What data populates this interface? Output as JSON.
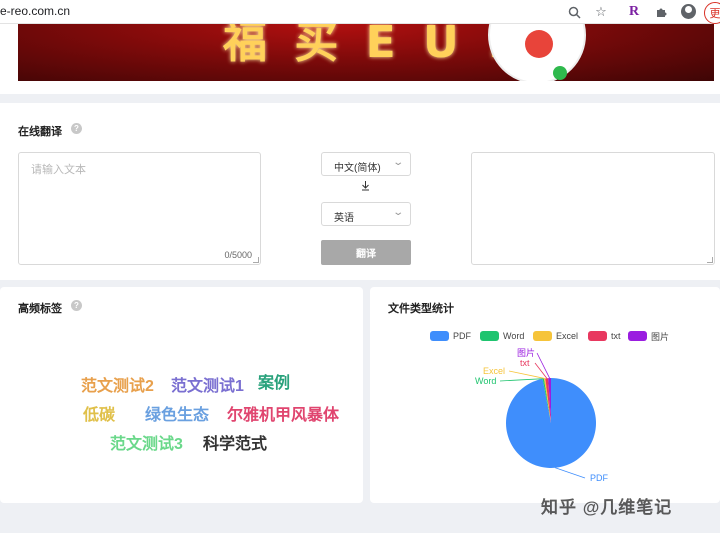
{
  "browser": {
    "url": "e-reo.com.cn",
    "zoom_icon": "zoom-icon",
    "star_icon": "star-icon",
    "extension_r": "R",
    "puzzle_icon": "puzzle-icon",
    "profile_label": "更"
  },
  "translate_panel": {
    "title": "在线翻译",
    "input_placeholder": "请输入文本",
    "char_counter": "0/5000",
    "source_language": "中文(简体)",
    "target_language": "英语",
    "translate_button": "翻译"
  },
  "tags_panel": {
    "title": "高频标签",
    "tags": [
      {
        "text": "范文测试2",
        "color": "#e8a04c"
      },
      {
        "text": "范文测试1",
        "color": "#7a6fd1"
      },
      {
        "text": "案例",
        "color": "#2aa27c"
      },
      {
        "text": "低碳",
        "color": "#e0c04a"
      },
      {
        "text": "绿色生态",
        "color": "#6aa0e0"
      },
      {
        "text": "尔雅机甲风暴体",
        "color": "#e0456f"
      },
      {
        "text": "范文测试3",
        "color": "#6ad88a"
      },
      {
        "text": "科学范式",
        "color": "#333333"
      }
    ]
  },
  "chart_panel": {
    "title": "文件类型统计"
  },
  "chart_data": {
    "type": "pie",
    "title": "",
    "legend_position": "top",
    "categories": [
      "PDF",
      "Word",
      "Excel",
      "txt",
      "图片"
    ],
    "values": [
      97,
      0.5,
      0.5,
      1,
      1
    ],
    "colors": [
      "#3f8efc",
      "#1fc46f",
      "#f6c43a",
      "#e8385f",
      "#9a1de0"
    ]
  },
  "watermark": "知乎 @几维笔记"
}
